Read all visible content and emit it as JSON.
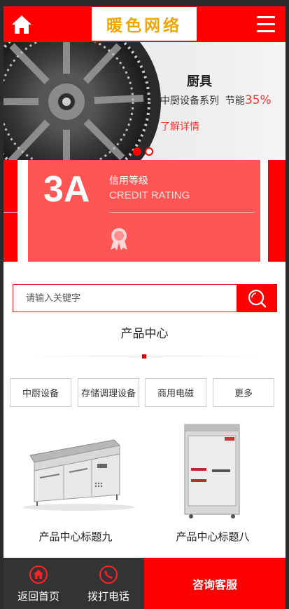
{
  "header": {
    "logo_text": "暖色网络",
    "home_icon": "home-icon",
    "menu_icon": "menu-icon"
  },
  "banner": {
    "title": "厨具",
    "subtitle_prefix": "中厨设备系列  节能",
    "subtitle_highlight": "35%",
    "link": "了解详情",
    "slide_count": 2,
    "active_slide": 1
  },
  "credit": {
    "big": "3A",
    "cn": "信用等级",
    "en": "CREDIT RATING",
    "icon": "award-icon"
  },
  "search": {
    "placeholder": "请输入关键字",
    "value": "",
    "icon": "search-icon"
  },
  "products": {
    "section_title": "产品中心",
    "categories": [
      {
        "label": "中厨设备"
      },
      {
        "label": "存储调理设备"
      },
      {
        "label": "商用电磁"
      },
      {
        "label": "更多"
      }
    ],
    "items": [
      {
        "title": "产品中心标题九"
      },
      {
        "title": "产品中心标题八"
      }
    ]
  },
  "bottom_bar": {
    "home": {
      "label": "返回首页",
      "icon": "home-circle-icon"
    },
    "phone": {
      "label": "拨打电话",
      "icon": "phone-circle-icon"
    },
    "consult": {
      "label": "咨询客服"
    }
  },
  "colors": {
    "accent": "#ff0000",
    "credit_card": "#ff5555",
    "logo": "#f0a500",
    "bottom_bar": "#333333"
  }
}
